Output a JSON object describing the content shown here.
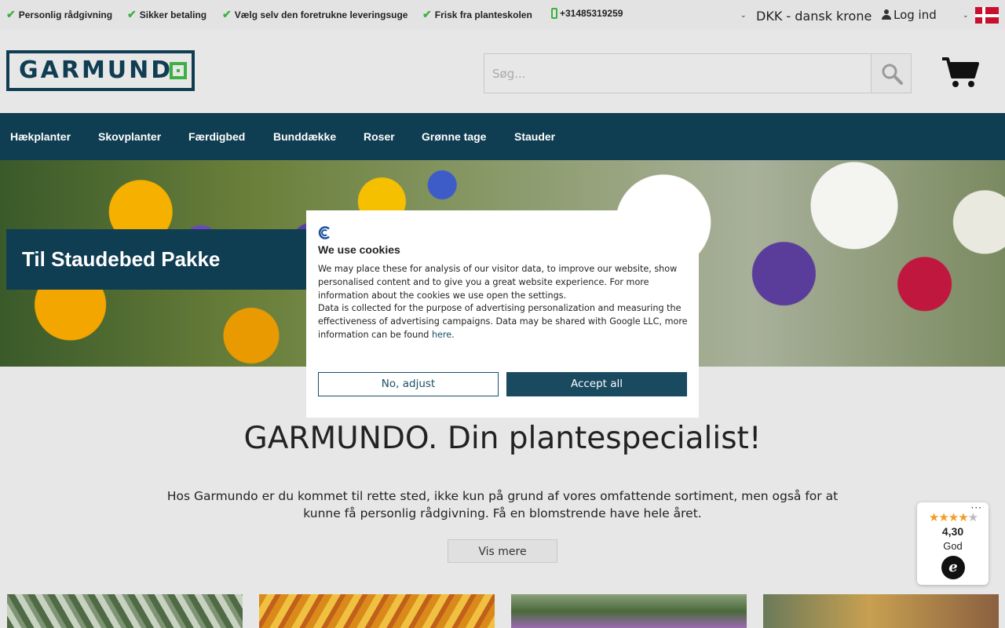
{
  "topbar": {
    "usps": [
      "Personlig rådgivning",
      "Sikker betaling",
      "Vælg selv den foretrukne leveringsuge",
      "Frisk fra planteskolen"
    ],
    "phone": "+31485319259",
    "currency": "DKK - dansk krone",
    "login": "Log ind",
    "check_glyph": "✔",
    "chevron_glyph": "⌄"
  },
  "header": {
    "logo_text": "GARMUND",
    "search_placeholder": "Søg..."
  },
  "nav": {
    "items": [
      "Hækplanter",
      "Skovplanter",
      "Færdigbed",
      "Bunddække",
      "Roser",
      "Grønne tage",
      "Stauder"
    ]
  },
  "hero": {
    "caption": "Til Staudebed Pakke"
  },
  "main": {
    "title": "GARMUNDO. Din plantespecialist!",
    "text": "Hos Garmundo er du kommet til rette sted, ikke kun på grund af vores omfattende sortiment, men også for at kunne få personlig rådgivning. Få en blomstrende have hele året.",
    "more_button": "Vis mere"
  },
  "cookie": {
    "title": "We use cookies",
    "paragraph1": "We may place these for analysis of our visitor data, to improve our website, show personalised content and to give you a great website experience. For more information about the cookies we use open the settings.",
    "paragraph2": "Data is collected for the purpose of advertising personalization and measuring the effectiveness of advertising campaigns. Data may be shared with Google LLC, more information can be found",
    "link": "here",
    "period": ".",
    "adjust_button": "No, adjust",
    "accept_button": "Accept all"
  },
  "trust": {
    "menu": "···",
    "stars": "★★★★",
    "half_star": "★",
    "score": "4,30",
    "label": "God",
    "logo": "e"
  },
  "colors": {
    "brand_dark": "#0f3d52",
    "brand_green": "#3cb043",
    "accept": "#194a60"
  }
}
